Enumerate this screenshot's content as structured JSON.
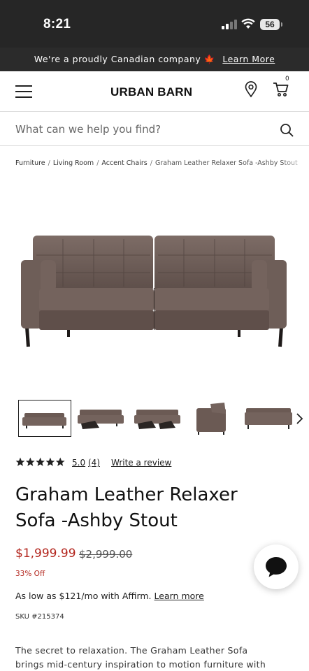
{
  "status_bar": {
    "time": "8:21",
    "battery": "56"
  },
  "promo": {
    "text": "We're a proudly Canadian company",
    "link": "Learn More"
  },
  "header": {
    "logo": "URBAN BARN",
    "cart_count": "0"
  },
  "search": {
    "placeholder": "What can we help you find?"
  },
  "breadcrumb": [
    "Furniture",
    "Living Room",
    "Accent Chairs",
    "Graham Leather Relaxer Sofa -Ashby Stout"
  ],
  "product": {
    "rating": "5.0",
    "review_count": "(4)",
    "write_review": "Write a review",
    "title": "Graham Leather Relaxer Sofa -Ashby Stout",
    "price": "$1,999.99",
    "price_old": "$2,999.00",
    "discount": "33% Off",
    "affirm_prefix": "As low as",
    "affirm_amount": "$121",
    "affirm_suffix": "/mo with Affirm.",
    "affirm_link": "Learn more",
    "sku": "SKU #215374",
    "description_line1": "The secret to relaxation. The Graham Leather Sofa",
    "description_line2": "brings mid-century inspiration to motion furniture with"
  },
  "colors": {
    "accent_red": "#b3261e",
    "leather": "#6b5a54",
    "dark_bar": "#262626"
  },
  "icons": [
    "menu-icon",
    "location-pin-icon",
    "cart-icon",
    "search-icon",
    "star-icon",
    "chevron-right-icon",
    "chat-icon",
    "maple-leaf-icon"
  ]
}
